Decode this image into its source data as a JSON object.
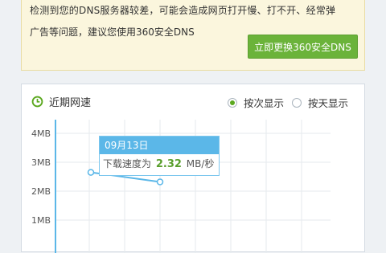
{
  "banner": {
    "line1": "检测到您的DNS服务器较差，可能会造成网页打开慢、打不开、经常弹",
    "line2": "广告等问题，建议您使用360安全DNS",
    "button_label": "立即更换360安全DNS"
  },
  "panel": {
    "title": "近期网速",
    "icon": "clock-icon",
    "options": [
      {
        "label": "按次显示",
        "checked": true
      },
      {
        "label": "按天显示",
        "checked": false
      }
    ]
  },
  "colors": {
    "accent_green": "#6bb33a",
    "chart_blue": "#5bb7e8"
  },
  "chart_data": {
    "type": "line",
    "y_ticks": [
      "4MB",
      "3MB",
      "2MB",
      "1MB"
    ],
    "ylim": [
      0,
      4.5
    ],
    "unit": "MB",
    "grid": true,
    "series": [
      {
        "values": [
          2.65,
          2.32
        ]
      }
    ],
    "tooltip": {
      "date": "09月13日",
      "prefix": "下载速度为",
      "value": "2.32",
      "unit": "MB/秒"
    }
  }
}
